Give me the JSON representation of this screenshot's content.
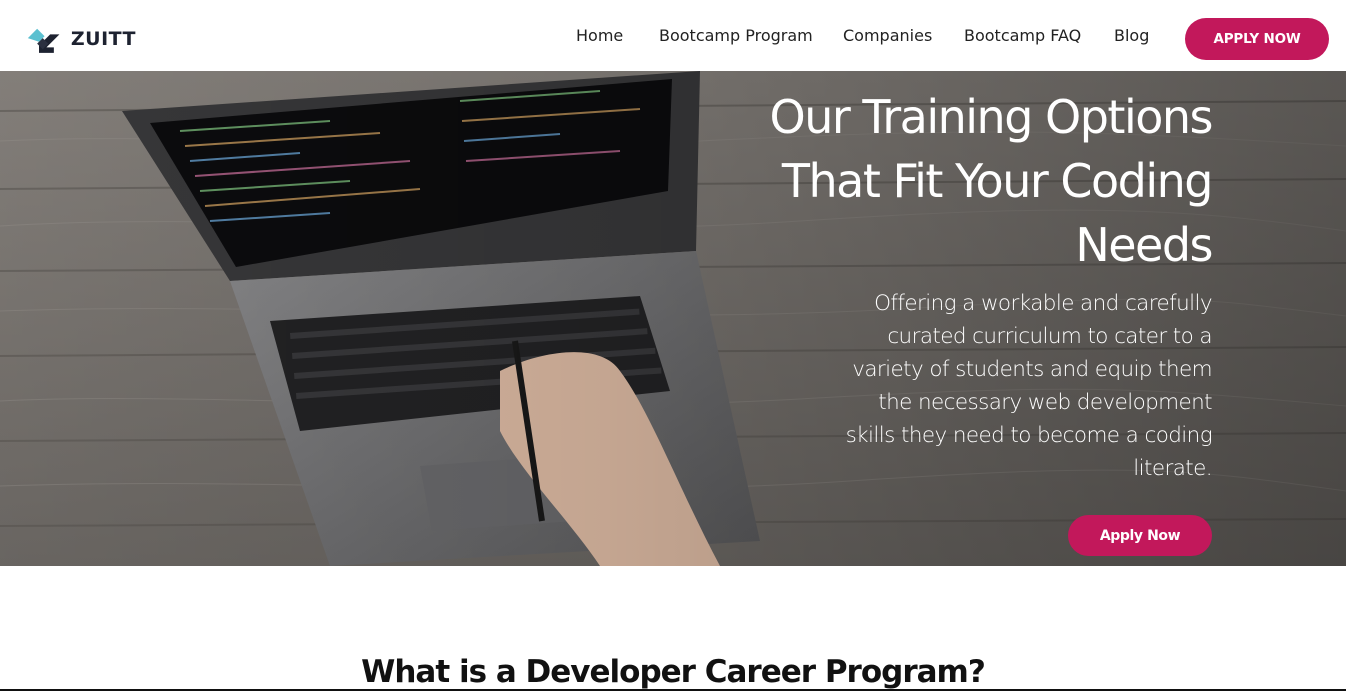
{
  "header": {
    "logo_text": "ZUITT",
    "nav": [
      "Home",
      "Bootcamp Program",
      "Companies",
      "Bootcamp FAQ",
      "Blog"
    ],
    "apply_label": "APPLY NOW"
  },
  "hero": {
    "title_lines": [
      "Our Training Options",
      "That Fit Your Coding",
      "Needs"
    ],
    "subtitle_lines": [
      "Offering a workable and carefully",
      "curated curriculum to cater to a",
      "variety of students and equip them",
      "the necessary web development",
      "skills they need to become a coding",
      "literate."
    ],
    "cta_label": "Apply Now"
  },
  "section": {
    "title": "What is a Developer Career Program?"
  },
  "colors": {
    "accent": "#c2185b",
    "logo_teal": "#5bc0d0",
    "logo_dark": "#1d2230"
  },
  "icons": {
    "logo": "zuitt-logo-icon"
  }
}
